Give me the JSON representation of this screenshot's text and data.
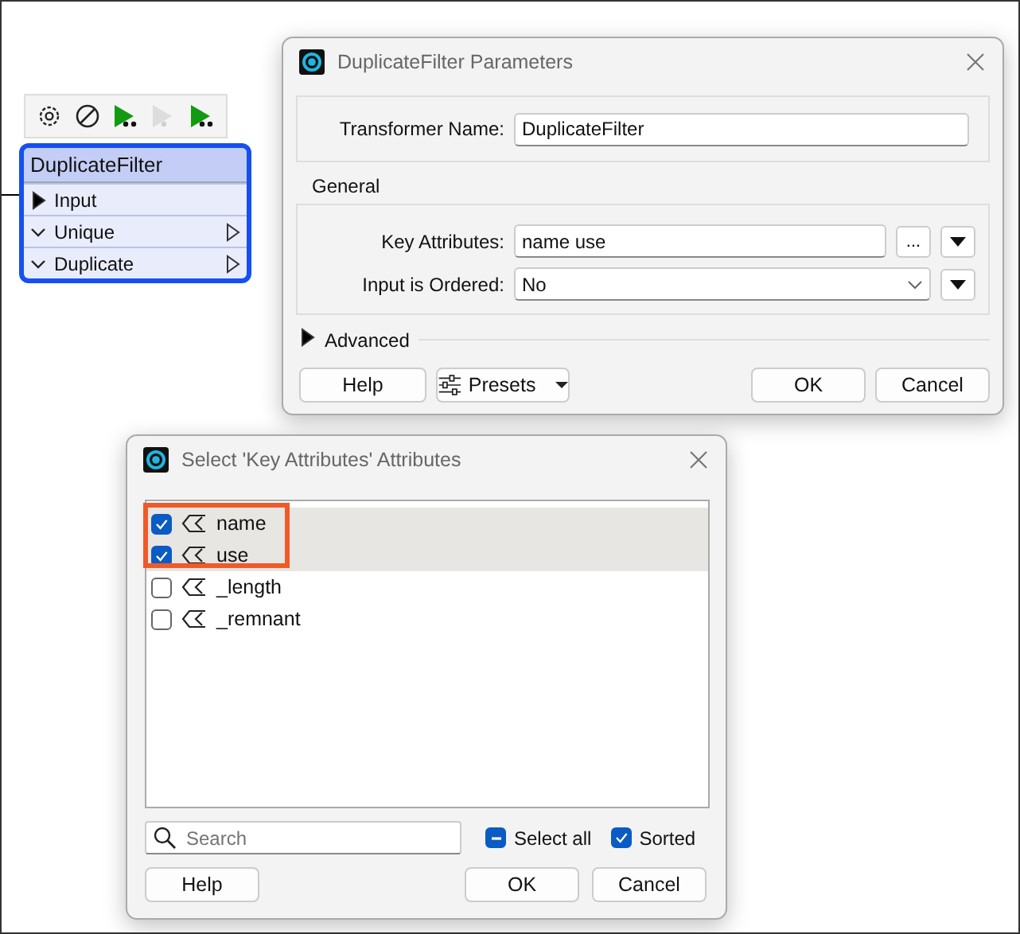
{
  "node_toolbar": [
    {
      "kind": "settings",
      "disabled": false
    },
    {
      "kind": "disable",
      "disabled": false
    },
    {
      "kind": "run",
      "disabled": false
    },
    {
      "kind": "run",
      "disabled": true
    },
    {
      "kind": "run",
      "disabled": false
    }
  ],
  "node": {
    "title": "DuplicateFilter",
    "selected": true,
    "ports": [
      {
        "kind": "input",
        "label": "Input"
      },
      {
        "kind": "output",
        "label": "Unique"
      },
      {
        "kind": "output",
        "label": "Duplicate"
      }
    ]
  },
  "parameters_dialog": {
    "title": "DuplicateFilter Parameters",
    "transformer_name_label": "Transformer Name:",
    "transformer_name": "DuplicateFilter",
    "group_title": "General",
    "fields": [
      {
        "kind": "text",
        "label": "Key Attributes:",
        "value": "name use",
        "browse": "..."
      },
      {
        "kind": "select",
        "label": "Input is Ordered:",
        "value": "No"
      }
    ],
    "advanced": {
      "label": "Advanced",
      "expanded": false
    },
    "buttons": [
      {
        "kind": "help",
        "label": "Help"
      },
      {
        "kind": "presets",
        "label": "Presets"
      },
      {
        "kind": "ok",
        "label": "OK"
      },
      {
        "kind": "cancel",
        "label": "Cancel"
      }
    ]
  },
  "select_dialog": {
    "title": "Select 'Key Attributes' Attributes",
    "highlight_selected": true,
    "attributes": [
      {
        "name": "name",
        "checked": true,
        "selected": true
      },
      {
        "name": "use",
        "checked": true,
        "selected": true
      },
      {
        "name": "_length",
        "checked": false,
        "selected": false
      },
      {
        "name": "_remnant",
        "checked": false,
        "selected": false
      }
    ],
    "search": {
      "placeholder": "Search"
    },
    "select_all": {
      "label": "Select all",
      "indeterminate": true
    },
    "sorted": {
      "label": "Sorted",
      "checked": true
    },
    "buttons": [
      "Help",
      "OK",
      "Cancel"
    ]
  }
}
